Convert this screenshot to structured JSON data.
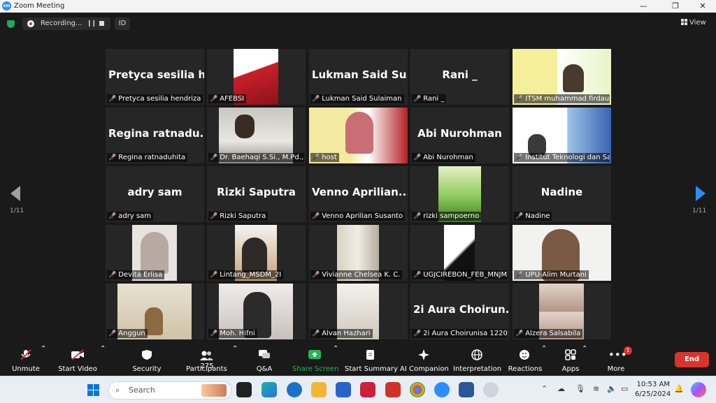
{
  "window": {
    "title": "Zoom Meeting",
    "app_icon": "zm"
  },
  "topbar": {
    "recording_label": "Recording...",
    "id_label": "ID",
    "view_label": "View"
  },
  "pager": {
    "left": "1/11",
    "right": "1/11"
  },
  "tiles": [
    {
      "big": "Pretyca sesilia h...",
      "label": "Pretyca sesilia hendriza"
    },
    {
      "big": "",
      "label": "AFEBSI"
    },
    {
      "big": "Lukman Said Su...",
      "label": "Lukman Said Sulaiman"
    },
    {
      "big": "Rani _",
      "label": "Rani _"
    },
    {
      "big": "",
      "label": "ITSM muhammad firdaus"
    },
    {
      "big": "Regina ratnadu...",
      "label": "Regina ratnaduhita"
    },
    {
      "big": "",
      "label": "Dr. Baehaqi S.Si., M.Pd., ..."
    },
    {
      "big": "",
      "label": "host"
    },
    {
      "big": "Abi Nurohman",
      "label": "Abi Nurohman"
    },
    {
      "big": "",
      "label": "Institut Teknologi dan Sai..."
    },
    {
      "big": "adry sam",
      "label": "adry sam"
    },
    {
      "big": "Rizki Saputra",
      "label": "Rizki Saputra"
    },
    {
      "big": "Venno Aprilian...",
      "label": "Venno Aprilian Susanto"
    },
    {
      "big": "",
      "label": "rizki sampoerno"
    },
    {
      "big": "Nadine",
      "label": "Nadine"
    },
    {
      "big": "",
      "label": "Devita Erlisa"
    },
    {
      "big": "",
      "label": "Lintang_MSDM_2I"
    },
    {
      "big": "",
      "label": "Vivianne Chelsea K. C."
    },
    {
      "big": "",
      "label": "UGJCIREBON_FEB_MNJM..."
    },
    {
      "big": "",
      "label": "UPU-Alim Murtani"
    },
    {
      "big": "",
      "label": "Anggun"
    },
    {
      "big": "",
      "label": "Moh. Hifni"
    },
    {
      "big": "",
      "label": "Alvan Hazhari"
    },
    {
      "big": "2i Aura Choirun...",
      "label": "2i Aura Choirunisa 12202..."
    },
    {
      "big": "",
      "label": "Alzera Salsabila"
    }
  ],
  "toolbar": {
    "unmute": "Unmute",
    "start_video": "Start Video",
    "security": "Security",
    "participants": "Participants",
    "participants_count": "275",
    "qa": "Q&A",
    "share_screen": "Share Screen",
    "start_summary": "Start Summary",
    "ai_companion": "AI Companion",
    "interpretation": "Interpretation",
    "reactions": "Reactions",
    "apps": "Apps",
    "more": "More",
    "more_badge": "1",
    "end": "End"
  },
  "taskbar": {
    "search_placeholder": "Search",
    "time": "10:53 AM",
    "date": "6/25/2024"
  },
  "colors": {
    "zoom_blue": "#2d8cff",
    "end_red": "#d9342b",
    "share_green": "#1db954",
    "active_speaker": "#c5e14b"
  }
}
